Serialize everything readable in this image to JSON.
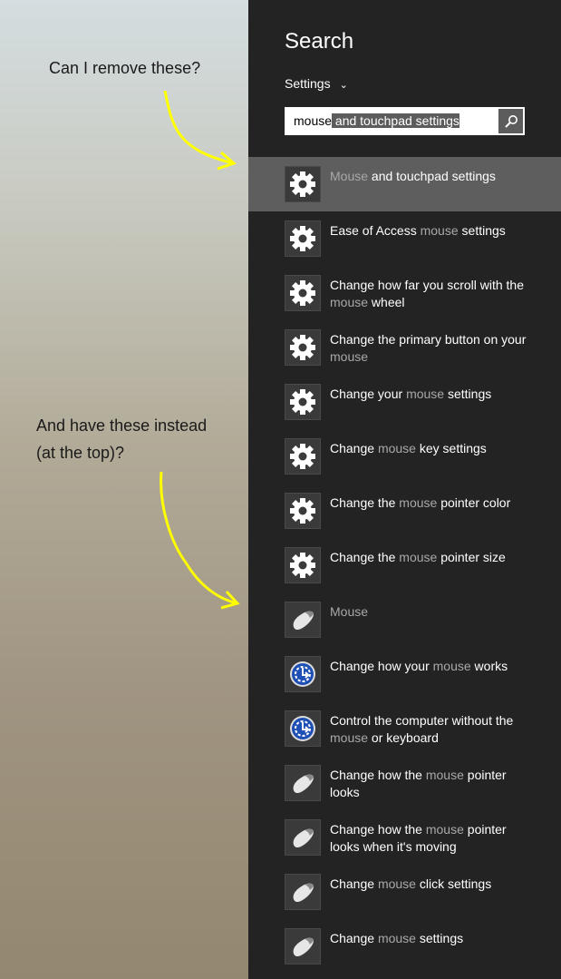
{
  "annotations": {
    "first": "Can I remove these?",
    "second": "And have these instead (at the top)?",
    "second_line1": "And have these instead",
    "second_line2": "(at the top)?",
    "arrow_color": "#ffff00"
  },
  "search": {
    "title": "Search",
    "scope": "Settings",
    "query_typed": "mouse",
    "query_suggested": " and touchpad settings",
    "button_icon": "search-icon"
  },
  "colors": {
    "panel": "#232323",
    "selected_row": "#5e5e5e",
    "match_text": "#a8a8a8"
  },
  "results": [
    {
      "icon": "gear",
      "pre": "",
      "match": "Mouse",
      "post": " and touchpad settings",
      "selected": true
    },
    {
      "icon": "gear",
      "pre": "Ease of Access ",
      "match": "mouse",
      "post": " settings"
    },
    {
      "icon": "gear",
      "pre": "Change how far you scroll with the ",
      "match": "mouse",
      "post": " wheel"
    },
    {
      "icon": "gear",
      "pre": "Change the primary button on your ",
      "match": "mouse",
      "post": ""
    },
    {
      "icon": "gear",
      "pre": "Change your ",
      "match": "mouse",
      "post": " settings"
    },
    {
      "icon": "gear",
      "pre": "Change ",
      "match": "mouse",
      "post": " key settings"
    },
    {
      "icon": "gear",
      "pre": "Change the ",
      "match": "mouse",
      "post": " pointer color"
    },
    {
      "icon": "gear",
      "pre": "Change the ",
      "match": "mouse",
      "post": " pointer size"
    },
    {
      "icon": "mouse",
      "pre": "",
      "match": "Mouse",
      "post": ""
    },
    {
      "icon": "ease-of-access",
      "pre": "Change how your ",
      "match": "mouse",
      "post": " works"
    },
    {
      "icon": "ease-of-access",
      "pre": "Control the computer without the ",
      "match": "mouse",
      "post": " or keyboard"
    },
    {
      "icon": "mouse",
      "pre": "Change how the ",
      "match": "mouse",
      "post": " pointer looks"
    },
    {
      "icon": "mouse",
      "pre": "Change how the ",
      "match": "mouse",
      "post": " pointer looks when it's moving"
    },
    {
      "icon": "mouse",
      "pre": "Change ",
      "match": "mouse",
      "post": " click settings"
    },
    {
      "icon": "mouse",
      "pre": "Change ",
      "match": "mouse",
      "post": " settings"
    }
  ]
}
